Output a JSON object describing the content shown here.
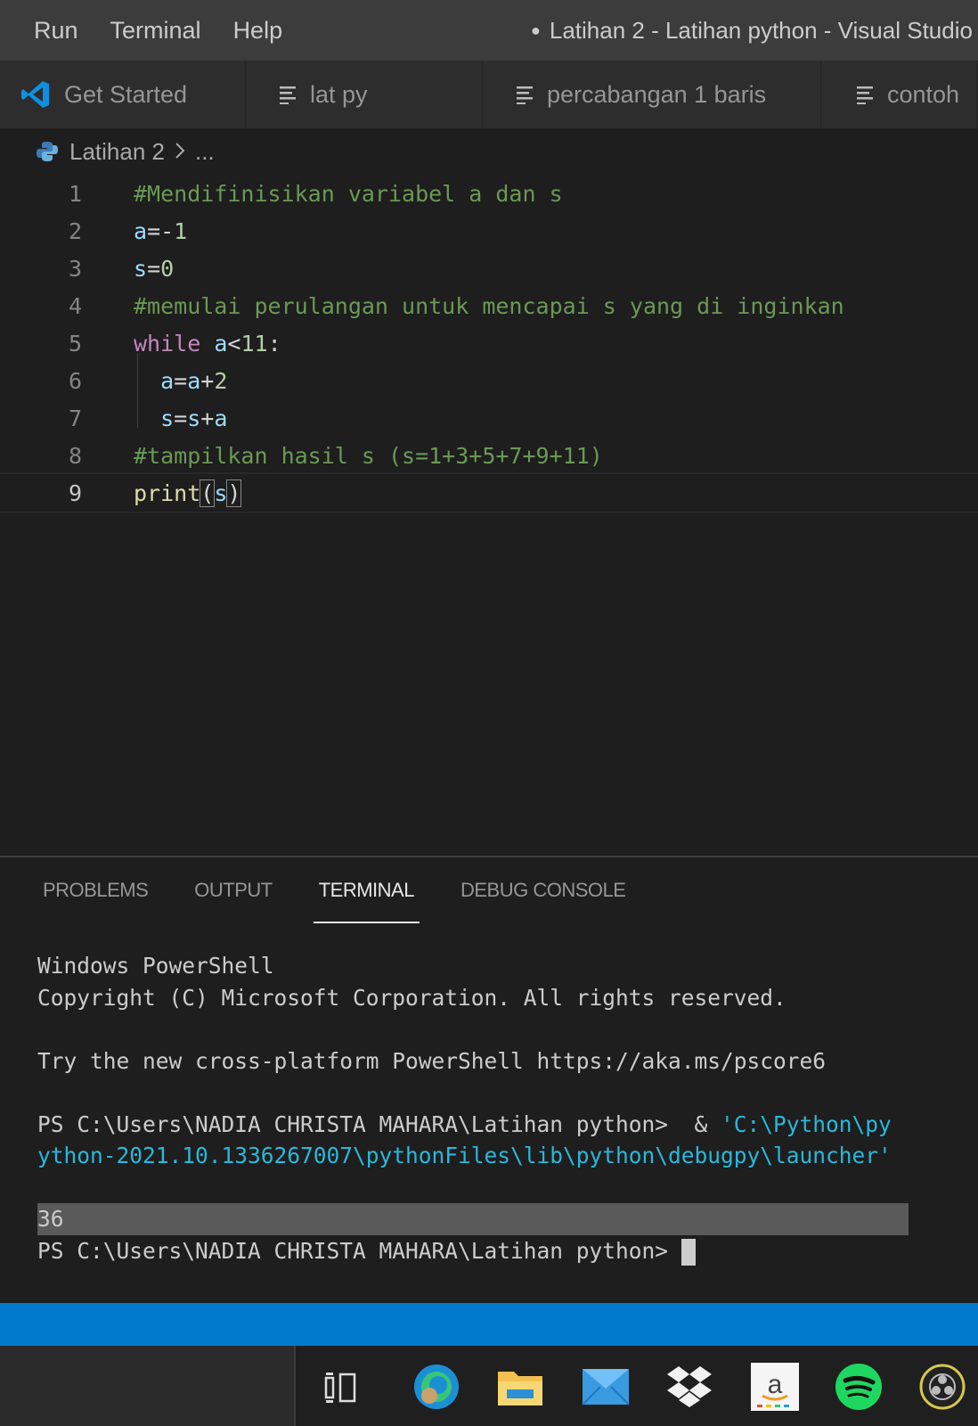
{
  "menubar": {
    "items": [
      "Run",
      "Terminal",
      "Help"
    ],
    "window_title": "Latihan 2 - Latihan python - Visual Studio"
  },
  "tabs": [
    {
      "label": "Get Started",
      "icon": "vscode-icon"
    },
    {
      "label": "lat py",
      "icon": "lines-icon"
    },
    {
      "label": "percabangan 1 baris",
      "icon": "lines-icon"
    },
    {
      "label": "contoh",
      "icon": "lines-icon"
    }
  ],
  "breadcrumb": {
    "file": "Latihan 2",
    "more": "..."
  },
  "editor": {
    "active_line": 9,
    "line_numbers": [
      "1",
      "2",
      "3",
      "4",
      "5",
      "6",
      "7",
      "8",
      "9"
    ],
    "lines": {
      "l1_comment": "#Mendifinisikan variabel a dan s",
      "l2_var": "a",
      "l2_op": "=-",
      "l2_num": "1",
      "l3_var": "s",
      "l3_op": "=",
      "l3_num": "0",
      "l4_comment": "#memulai perulangan untuk mencapai s yang di inginkan",
      "l5_kw": "while",
      "l5_var": "a",
      "l5_op": "<",
      "l5_num": "11",
      "l5_colon": ":",
      "l6_var1": "a",
      "l6_op1": "=",
      "l6_var2": "a",
      "l6_op2": "+",
      "l6_num": "2",
      "l7_var1": "s",
      "l7_op1": "=",
      "l7_var2": "s",
      "l7_op2": "+",
      "l7_var3": "a",
      "l8_comment": "#tampilkan hasil s (s=1+3+5+7+9+11)",
      "l9_fn": "print",
      "l9_open": "(",
      "l9_var": "s",
      "l9_close": ")"
    }
  },
  "panel": {
    "tabs": [
      "PROBLEMS",
      "OUTPUT",
      "TERMINAL",
      "DEBUG CONSOLE"
    ],
    "active_tab": "TERMINAL",
    "terminal": {
      "line1": "Windows PowerShell",
      "line2": "Copyright (C) Microsoft Corporation. All rights reserved.",
      "line3": "",
      "line4": "Try the new cross-platform PowerShell https://aka.ms/pscore6",
      "line5": "",
      "line6_prompt": "PS C:\\Users\\NADIA CHRISTA MAHARA\\Latihan python>  & ",
      "line6_path": "'C:\\Python\\py",
      "line7_path": "ython-2021.10.1336267007\\pythonFiles\\lib\\python\\debugpy\\launcher'",
      "line8": "",
      "output": "36",
      "last_prompt": "PS C:\\Users\\NADIA CHRISTA MAHARA\\Latihan python> "
    }
  },
  "colors": {
    "status_bar": "#007acc",
    "comment": "#6a9955",
    "keyword": "#c586c0",
    "variable": "#9cdcfe",
    "number": "#b5cea8",
    "function": "#dcdcaa"
  },
  "taskbar": {
    "icons": [
      "task-view-icon",
      "edge-icon",
      "file-explorer-icon",
      "mail-icon",
      "dropbox-icon",
      "amazon-icon",
      "spotify-icon",
      "obs-icon"
    ]
  }
}
